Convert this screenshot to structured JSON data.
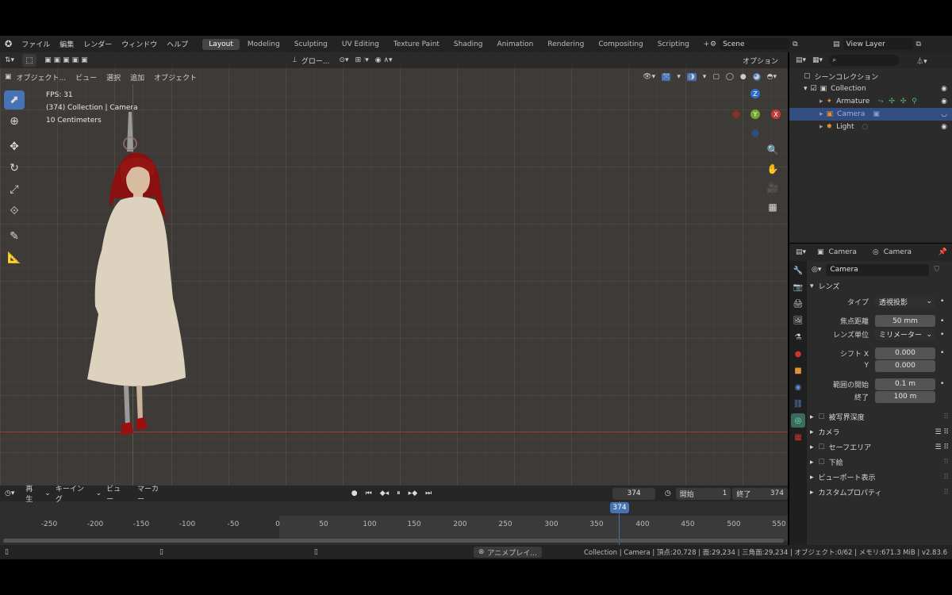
{
  "menubar": {
    "menus": [
      "ファイル",
      "編集",
      "レンダー",
      "ウィンドウ",
      "ヘルプ"
    ],
    "workspaces": [
      "Layout",
      "Modeling",
      "Sculpting",
      "UV Editing",
      "Texture Paint",
      "Shading",
      "Animation",
      "Rendering",
      "Compositing",
      "Scripting"
    ],
    "scene": "Scene",
    "view_layer": "View Layer"
  },
  "viewport": {
    "header_left": [
      "オブジェクト...",
      "ビュー",
      "選択",
      "追加",
      "オブジェクト"
    ],
    "header_top": "グロー...",
    "options": "オプション",
    "overlay_text": [
      "FPS: 31",
      "(374) Collection | Camera",
      "10 Centimeters"
    ],
    "gizmo": {
      "z": "Z",
      "y": "Y",
      "x": "X"
    }
  },
  "outliner": {
    "title": "シーンコレクション",
    "collection": "Collection",
    "items": [
      "Armature",
      "Camera",
      "Light"
    ]
  },
  "properties": {
    "header_object": "Camera",
    "header_data": "Camera",
    "data_name": "Camera",
    "lens_section": "レンズ",
    "type_label": "タイプ",
    "type_value": "透視投影",
    "focal_label": "焦点距離",
    "focal_value": "50 mm",
    "lens_unit_label": "レンズ単位",
    "lens_unit_value": "ミリメーター",
    "shift_x_label": "シフト X",
    "shift_x_value": "0.000",
    "shift_y_label": "Y",
    "shift_y_value": "0.000",
    "clip_start_label": "範囲の開始",
    "clip_start_value": "0.1 m",
    "clip_end_label": "終了",
    "clip_end_value": "100 m",
    "panels": [
      "被写界深度",
      "カメラ",
      "セーフエリア",
      "下絵",
      "ビューポート表示",
      "カスタムプロパティ"
    ]
  },
  "timeline": {
    "menus": [
      "再生",
      "キーイング",
      "ビュー",
      "マーカー"
    ],
    "current_frame": "374",
    "start_label": "開始",
    "start_value": "1",
    "end_label": "終了",
    "end_value": "374",
    "ticks": [
      "-250",
      "-200",
      "-150",
      "-100",
      "-50",
      "0",
      "50",
      "100",
      "150",
      "200",
      "250",
      "300",
      "350",
      "400",
      "450",
      "500",
      "550"
    ],
    "playhead": "374"
  },
  "statusbar": {
    "center": "アニメプレイ...",
    "right": "Collection | Camera | 頂点:20,728 | 面:29,234 | 三角面:29,234 | オブジェクト:0/62 | メモリ:671.3 MiB | v2.83.6"
  }
}
